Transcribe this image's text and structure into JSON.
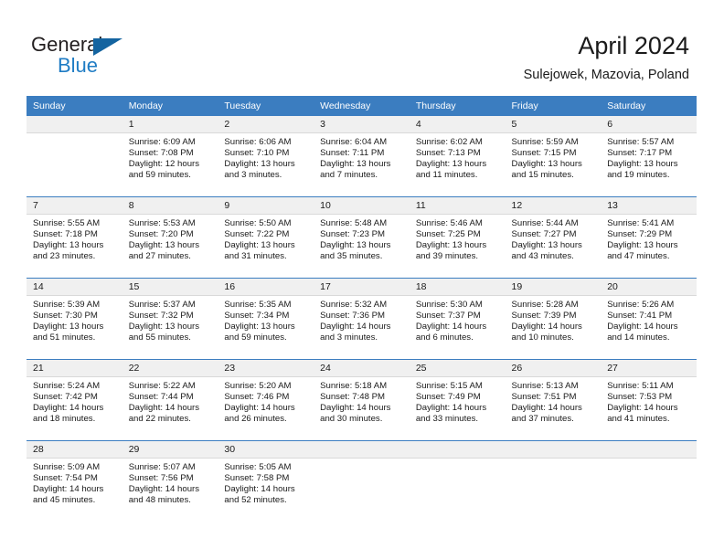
{
  "brand": {
    "name_dark": "General",
    "name_blue": "Blue",
    "color_dark": "#231f20",
    "color_blue": "#1f7cc4"
  },
  "header": {
    "title": "April 2024",
    "location": "Sulejowek, Mazovia, Poland"
  },
  "theme": {
    "header_row_bg": "#3b7dc0",
    "day_strip_bg": "#f0f0f0",
    "grid_line": "#3b7dc0",
    "text": "#1a1a1a"
  },
  "weekdays": [
    "Sunday",
    "Monday",
    "Tuesday",
    "Wednesday",
    "Thursday",
    "Friday",
    "Saturday"
  ],
  "labels": {
    "sunrise": "Sunrise:",
    "sunset": "Sunset:",
    "daylight": "Daylight:"
  },
  "weeks": [
    [
      {
        "day": "",
        "empty": true
      },
      {
        "day": "1",
        "sunrise": "Sunrise: 6:09 AM",
        "sunset": "Sunset: 7:08 PM",
        "daylight1": "Daylight: 12 hours",
        "daylight2": "and 59 minutes."
      },
      {
        "day": "2",
        "sunrise": "Sunrise: 6:06 AM",
        "sunset": "Sunset: 7:10 PM",
        "daylight1": "Daylight: 13 hours",
        "daylight2": "and 3 minutes."
      },
      {
        "day": "3",
        "sunrise": "Sunrise: 6:04 AM",
        "sunset": "Sunset: 7:11 PM",
        "daylight1": "Daylight: 13 hours",
        "daylight2": "and 7 minutes."
      },
      {
        "day": "4",
        "sunrise": "Sunrise: 6:02 AM",
        "sunset": "Sunset: 7:13 PM",
        "daylight1": "Daylight: 13 hours",
        "daylight2": "and 11 minutes."
      },
      {
        "day": "5",
        "sunrise": "Sunrise: 5:59 AM",
        "sunset": "Sunset: 7:15 PM",
        "daylight1": "Daylight: 13 hours",
        "daylight2": "and 15 minutes."
      },
      {
        "day": "6",
        "sunrise": "Sunrise: 5:57 AM",
        "sunset": "Sunset: 7:17 PM",
        "daylight1": "Daylight: 13 hours",
        "daylight2": "and 19 minutes."
      }
    ],
    [
      {
        "day": "7",
        "sunrise": "Sunrise: 5:55 AM",
        "sunset": "Sunset: 7:18 PM",
        "daylight1": "Daylight: 13 hours",
        "daylight2": "and 23 minutes."
      },
      {
        "day": "8",
        "sunrise": "Sunrise: 5:53 AM",
        "sunset": "Sunset: 7:20 PM",
        "daylight1": "Daylight: 13 hours",
        "daylight2": "and 27 minutes."
      },
      {
        "day": "9",
        "sunrise": "Sunrise: 5:50 AM",
        "sunset": "Sunset: 7:22 PM",
        "daylight1": "Daylight: 13 hours",
        "daylight2": "and 31 minutes."
      },
      {
        "day": "10",
        "sunrise": "Sunrise: 5:48 AM",
        "sunset": "Sunset: 7:23 PM",
        "daylight1": "Daylight: 13 hours",
        "daylight2": "and 35 minutes."
      },
      {
        "day": "11",
        "sunrise": "Sunrise: 5:46 AM",
        "sunset": "Sunset: 7:25 PM",
        "daylight1": "Daylight: 13 hours",
        "daylight2": "and 39 minutes."
      },
      {
        "day": "12",
        "sunrise": "Sunrise: 5:44 AM",
        "sunset": "Sunset: 7:27 PM",
        "daylight1": "Daylight: 13 hours",
        "daylight2": "and 43 minutes."
      },
      {
        "day": "13",
        "sunrise": "Sunrise: 5:41 AM",
        "sunset": "Sunset: 7:29 PM",
        "daylight1": "Daylight: 13 hours",
        "daylight2": "and 47 minutes."
      }
    ],
    [
      {
        "day": "14",
        "sunrise": "Sunrise: 5:39 AM",
        "sunset": "Sunset: 7:30 PM",
        "daylight1": "Daylight: 13 hours",
        "daylight2": "and 51 minutes."
      },
      {
        "day": "15",
        "sunrise": "Sunrise: 5:37 AM",
        "sunset": "Sunset: 7:32 PM",
        "daylight1": "Daylight: 13 hours",
        "daylight2": "and 55 minutes."
      },
      {
        "day": "16",
        "sunrise": "Sunrise: 5:35 AM",
        "sunset": "Sunset: 7:34 PM",
        "daylight1": "Daylight: 13 hours",
        "daylight2": "and 59 minutes."
      },
      {
        "day": "17",
        "sunrise": "Sunrise: 5:32 AM",
        "sunset": "Sunset: 7:36 PM",
        "daylight1": "Daylight: 14 hours",
        "daylight2": "and 3 minutes."
      },
      {
        "day": "18",
        "sunrise": "Sunrise: 5:30 AM",
        "sunset": "Sunset: 7:37 PM",
        "daylight1": "Daylight: 14 hours",
        "daylight2": "and 6 minutes."
      },
      {
        "day": "19",
        "sunrise": "Sunrise: 5:28 AM",
        "sunset": "Sunset: 7:39 PM",
        "daylight1": "Daylight: 14 hours",
        "daylight2": "and 10 minutes."
      },
      {
        "day": "20",
        "sunrise": "Sunrise: 5:26 AM",
        "sunset": "Sunset: 7:41 PM",
        "daylight1": "Daylight: 14 hours",
        "daylight2": "and 14 minutes."
      }
    ],
    [
      {
        "day": "21",
        "sunrise": "Sunrise: 5:24 AM",
        "sunset": "Sunset: 7:42 PM",
        "daylight1": "Daylight: 14 hours",
        "daylight2": "and 18 minutes."
      },
      {
        "day": "22",
        "sunrise": "Sunrise: 5:22 AM",
        "sunset": "Sunset: 7:44 PM",
        "daylight1": "Daylight: 14 hours",
        "daylight2": "and 22 minutes."
      },
      {
        "day": "23",
        "sunrise": "Sunrise: 5:20 AM",
        "sunset": "Sunset: 7:46 PM",
        "daylight1": "Daylight: 14 hours",
        "daylight2": "and 26 minutes."
      },
      {
        "day": "24",
        "sunrise": "Sunrise: 5:18 AM",
        "sunset": "Sunset: 7:48 PM",
        "daylight1": "Daylight: 14 hours",
        "daylight2": "and 30 minutes."
      },
      {
        "day": "25",
        "sunrise": "Sunrise: 5:15 AM",
        "sunset": "Sunset: 7:49 PM",
        "daylight1": "Daylight: 14 hours",
        "daylight2": "and 33 minutes."
      },
      {
        "day": "26",
        "sunrise": "Sunrise: 5:13 AM",
        "sunset": "Sunset: 7:51 PM",
        "daylight1": "Daylight: 14 hours",
        "daylight2": "and 37 minutes."
      },
      {
        "day": "27",
        "sunrise": "Sunrise: 5:11 AM",
        "sunset": "Sunset: 7:53 PM",
        "daylight1": "Daylight: 14 hours",
        "daylight2": "and 41 minutes."
      }
    ],
    [
      {
        "day": "28",
        "sunrise": "Sunrise: 5:09 AM",
        "sunset": "Sunset: 7:54 PM",
        "daylight1": "Daylight: 14 hours",
        "daylight2": "and 45 minutes."
      },
      {
        "day": "29",
        "sunrise": "Sunrise: 5:07 AM",
        "sunset": "Sunset: 7:56 PM",
        "daylight1": "Daylight: 14 hours",
        "daylight2": "and 48 minutes."
      },
      {
        "day": "30",
        "sunrise": "Sunrise: 5:05 AM",
        "sunset": "Sunset: 7:58 PM",
        "daylight1": "Daylight: 14 hours",
        "daylight2": "and 52 minutes."
      },
      {
        "day": "",
        "empty": true
      },
      {
        "day": "",
        "empty": true
      },
      {
        "day": "",
        "empty": true
      },
      {
        "day": "",
        "empty": true
      }
    ]
  ]
}
